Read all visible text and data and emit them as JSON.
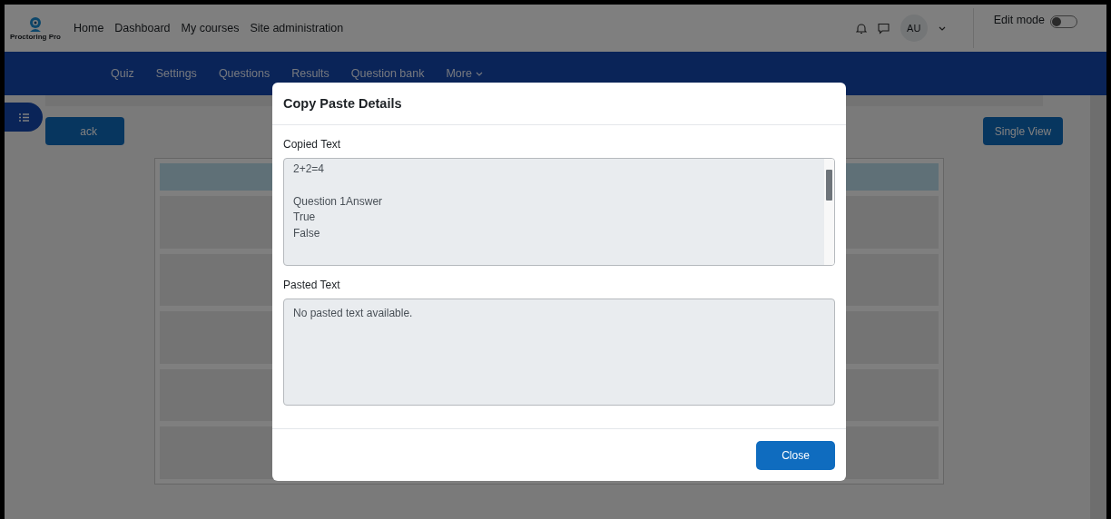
{
  "navbar": {
    "logo_text": "Proctoring Pro",
    "links": [
      "Home",
      "Dashboard",
      "My courses",
      "Site administration"
    ],
    "avatar": "AU",
    "edit_mode": {
      "label": "Edit mode",
      "on": false
    }
  },
  "secondary_nav": {
    "items": [
      "Quiz",
      "Settings",
      "Questions",
      "Results",
      "Question bank",
      "More"
    ]
  },
  "page": {
    "back_button": "ack",
    "single_view_button": "Single View"
  },
  "modal": {
    "title": "Copy Paste Details",
    "copied": {
      "label": "Copied Text",
      "value": "2+2=4\n\nQuestion 1Answer\nTrue\nFalse"
    },
    "pasted": {
      "label": "Pasted Text",
      "value": "No pasted text available."
    },
    "close_button": "Close"
  }
}
